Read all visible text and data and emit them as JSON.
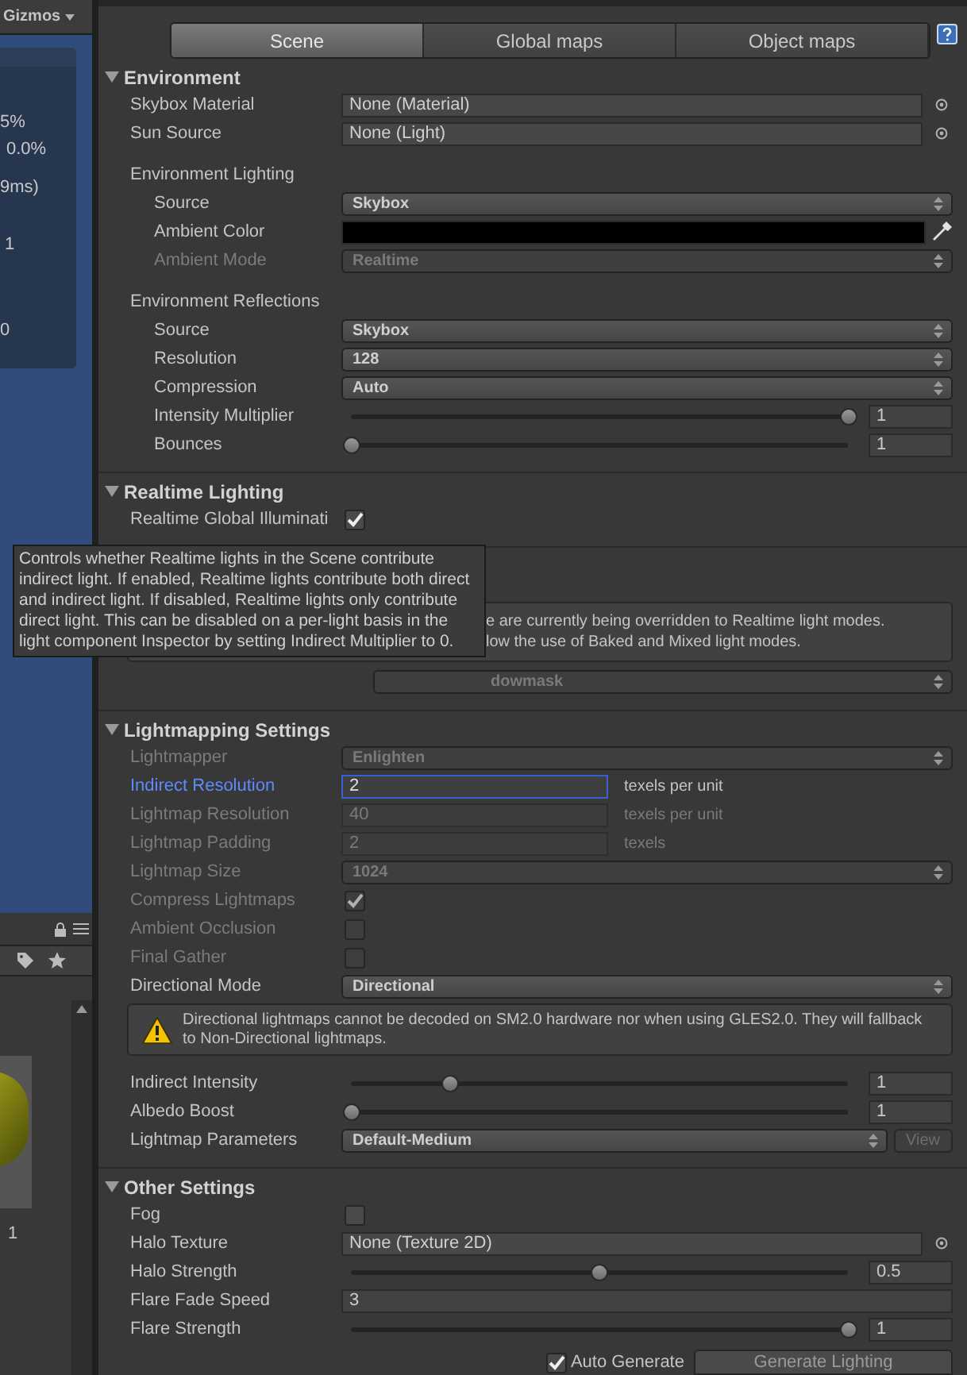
{
  "scene_view": {
    "toolbar_label": "Gizmos",
    "stats": [
      "5%",
      "0.0%",
      "9ms)",
      "1",
      "0"
    ]
  },
  "project_panel": {
    "preview_label": "1"
  },
  "tabs": [
    {
      "label": "Scene",
      "selected": true
    },
    {
      "label": "Global maps",
      "selected": false
    },
    {
      "label": "Object maps",
      "selected": false
    }
  ],
  "sections": [
    {
      "title": "Environment",
      "expanded": true,
      "rows": [
        {
          "kind": "object",
          "label": "Skybox Material",
          "value": "None (Material)"
        },
        {
          "kind": "object",
          "label": "Sun Source",
          "value": "None (Light)"
        },
        {
          "kind": "group",
          "label": "Environment Lighting",
          "children": [
            {
              "kind": "dropdown",
              "label": "Source",
              "value": "Skybox",
              "disabled": false
            },
            {
              "kind": "color",
              "label": "Ambient Color",
              "color": "#000000"
            },
            {
              "kind": "dropdown",
              "label": "Ambient Mode",
              "value": "Realtime",
              "disabled": true
            }
          ]
        },
        {
          "kind": "group",
          "label": "Environment Reflections",
          "children": [
            {
              "kind": "dropdown",
              "label": "Source",
              "value": "Skybox",
              "disabled": false
            },
            {
              "kind": "dropdown",
              "label": "Resolution",
              "value": "128",
              "disabled": false
            },
            {
              "kind": "dropdown",
              "label": "Compression",
              "value": "Auto",
              "disabled": false
            },
            {
              "kind": "slider",
              "label": "Intensity Multiplier",
              "level": 1,
              "reading": "1"
            },
            {
              "kind": "slider",
              "label": "Bounces",
              "level": 0,
              "reading": "1"
            }
          ]
        }
      ]
    },
    {
      "title": "Realtime Lighting",
      "expanded": true,
      "rows": [
        {
          "kind": "checkbox",
          "label": "Realtime Global Illuminati",
          "checked": true,
          "disabled": false
        }
      ]
    },
    {
      "rows": [
        {
          "kind": "covered_help",
          "lines": [
            "e are currently being overridden to Realtime light modes.",
            "low the use of Baked and Mixed light modes."
          ]
        },
        {
          "kind": "covered_dropdown",
          "value": "dowmask",
          "disabled": true
        }
      ]
    },
    {
      "title": "Lightmapping Settings",
      "expanded": true,
      "rows": [
        {
          "kind": "dropdown",
          "label": "Lightmapper",
          "value": "Enlighten",
          "disabled": true
        },
        {
          "kind": "number",
          "label": "Indirect Resolution",
          "value": "2",
          "suffix": "texels per unit",
          "disabled": false,
          "focused": true
        },
        {
          "kind": "number",
          "label": "Lightmap Resolution",
          "value": "40",
          "suffix": "texels per unit",
          "disabled": true,
          "focused": false
        },
        {
          "kind": "number",
          "label": "Lightmap Padding",
          "value": "2",
          "suffix": "texels",
          "disabled": true,
          "focused": false
        },
        {
          "kind": "dropdown",
          "label": "Lightmap Size",
          "value": "1024",
          "disabled": true
        },
        {
          "kind": "checkbox",
          "label": "Compress Lightmaps",
          "checked": true,
          "disabled": true
        },
        {
          "kind": "checkbox",
          "label": "Ambient Occlusion",
          "checked": false,
          "disabled": true
        },
        {
          "kind": "checkbox",
          "label": "Final Gather",
          "checked": false,
          "disabled": true
        },
        {
          "kind": "dropdown",
          "label": "Directional Mode",
          "value": "Directional",
          "disabled": false
        },
        {
          "kind": "warning",
          "text": "Directional lightmaps cannot be decoded on SM2.0 hardware nor when using GLES2.0. They will fallback to Non-Directional lightmaps."
        },
        {
          "kind": "slider",
          "label": "Indirect Intensity",
          "level": 0.2,
          "reading": "1"
        },
        {
          "kind": "slider",
          "label": "Albedo Boost",
          "level": 0,
          "reading": "1"
        },
        {
          "kind": "dropdown_button",
          "label": "Lightmap Parameters",
          "value": "Default-Medium",
          "button": "View",
          "button_disabled": true
        }
      ]
    },
    {
      "title": "Other Settings",
      "expanded": true,
      "rows": [
        {
          "kind": "checkbox",
          "label": "Fog",
          "checked": false,
          "disabled": false
        },
        {
          "kind": "object",
          "label": "Halo Texture",
          "value": "None (Texture 2D)"
        },
        {
          "kind": "slider",
          "label": "Halo Strength",
          "level": 0.5,
          "reading": "0.5"
        },
        {
          "kind": "text",
          "label": "Flare Fade Speed",
          "value": "3"
        },
        {
          "kind": "slider",
          "label": "Flare Strength",
          "level": 1,
          "reading": "1"
        }
      ]
    }
  ],
  "tooltip": "Controls whether Realtime lights in the Scene contribute indirect light. If enabled, Realtime lights contribute both direct and indirect light. If disabled, Realtime lights only contribute direct light. This can be disabled on a per-light basis in the light component Inspector by setting Indirect Multiplier to 0.",
  "auto_generate": {
    "label": "Auto Generate",
    "checked": true
  },
  "generate_button": "Generate Lighting"
}
